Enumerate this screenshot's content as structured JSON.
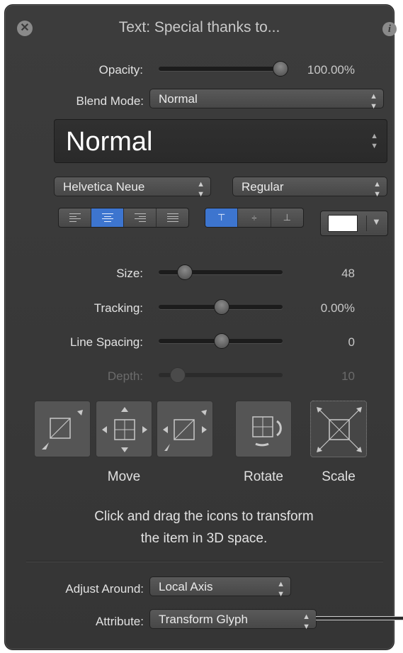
{
  "window": {
    "title": "Text: Special thanks to..."
  },
  "opacity": {
    "label": "Opacity:",
    "value": "100.00%",
    "level": 1.0
  },
  "blend_mode": {
    "label": "Blend Mode:",
    "value": "Normal"
  },
  "preset": {
    "value": "Normal"
  },
  "font": {
    "family": "Helvetica Neue",
    "style": "Regular"
  },
  "alignment": {
    "options": [
      "align-left",
      "align-center",
      "align-right",
      "justify"
    ],
    "selected": "align-center"
  },
  "vertical_alignment": {
    "options": [
      "top",
      "middle",
      "bottom"
    ],
    "selected": "top"
  },
  "text_color": "#ffffff",
  "accent_color": "#3d75cf",
  "size": {
    "label": "Size:",
    "value": "48",
    "level": 0.19
  },
  "tracking": {
    "label": "Tracking:",
    "value": "0.00%",
    "level": 0.5
  },
  "line_spacing": {
    "label": "Line Spacing:",
    "value": "0",
    "level": 0.5
  },
  "depth": {
    "label": "Depth:",
    "value": "10",
    "level": 0.13
  },
  "transform": {
    "move_label": "Move",
    "rotate_label": "Rotate",
    "scale_label": "Scale",
    "hint_line1": "Click and drag the icons to transform",
    "hint_line2": "the item in 3D space."
  },
  "adjust_around": {
    "label": "Adjust Around:",
    "value": "Local Axis"
  },
  "attribute": {
    "label": "Attribute:",
    "value": "Transform Glyph"
  }
}
